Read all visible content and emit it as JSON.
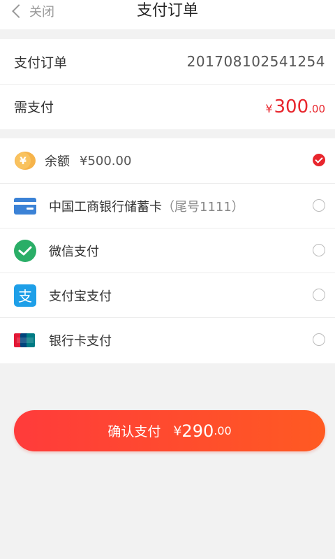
{
  "nav": {
    "back_label": "关闭",
    "title": "支付订单"
  },
  "order": {
    "order_label": "支付订单",
    "order_number": "201708102541254",
    "pay_label": "需支付",
    "currency": "¥",
    "amount_int": "300",
    "amount_dec": ".00"
  },
  "methods": [
    {
      "icon": "coin-icon",
      "label": "余额",
      "extra": "¥500.00",
      "selected": true
    },
    {
      "icon": "bank-card-icon",
      "label": "中国工商银行储蓄卡",
      "sub": "（尾号1111）",
      "selected": false
    },
    {
      "icon": "wechat-icon",
      "label": "微信支付",
      "selected": false
    },
    {
      "icon": "alipay-icon",
      "label": "支付宝支付",
      "selected": false
    },
    {
      "icon": "unionpay-icon",
      "label": "银行卡支付",
      "selected": false
    }
  ],
  "confirm": {
    "label": "确认支付",
    "currency": "¥",
    "amount_int": "290",
    "amount_dec": ".00"
  },
  "colors": {
    "accent": "#e8262d",
    "button_start": "#ff3b3b",
    "button_end": "#ff5a22"
  }
}
